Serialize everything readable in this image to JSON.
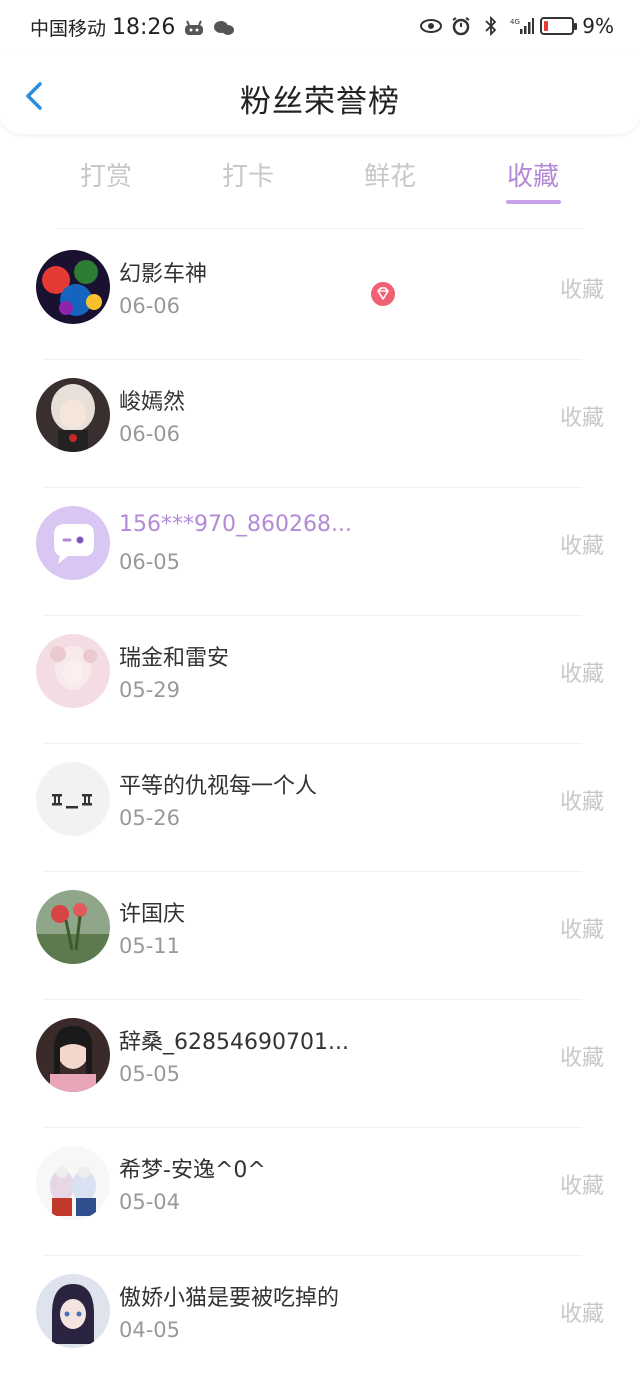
{
  "status": {
    "carrier": "中国移动",
    "time": "18:26",
    "battery": "9%"
  },
  "header": {
    "title": "粉丝荣誉榜"
  },
  "tabs": [
    {
      "label": "打赏"
    },
    {
      "label": "打卡"
    },
    {
      "label": "鲜花"
    },
    {
      "label": "收藏"
    }
  ],
  "list": [
    {
      "name": "幻影车神",
      "date": "06-06",
      "action": "收藏"
    },
    {
      "name": "峻嫣然",
      "date": "06-06",
      "action": "收藏"
    },
    {
      "name": "156***970_860268...",
      "date": "06-05",
      "action": "收藏"
    },
    {
      "name": "瑞金和雷安",
      "date": "05-29",
      "action": "收藏"
    },
    {
      "name": "平等的仇视每一个人",
      "date": "05-26",
      "action": "收藏"
    },
    {
      "name": "许国庆",
      "date": "05-11",
      "action": "收藏"
    },
    {
      "name": "辞桑_62854690701...",
      "date": "05-05",
      "action": "收藏"
    },
    {
      "name": "希梦-安逸^0^",
      "date": "05-04",
      "action": "收藏"
    },
    {
      "name": "傲娇小猫是要被吃掉的",
      "date": "04-05",
      "action": "收藏"
    }
  ],
  "colors": {
    "accent": "#b38ad6",
    "back_arrow": "#2a8cdb"
  }
}
